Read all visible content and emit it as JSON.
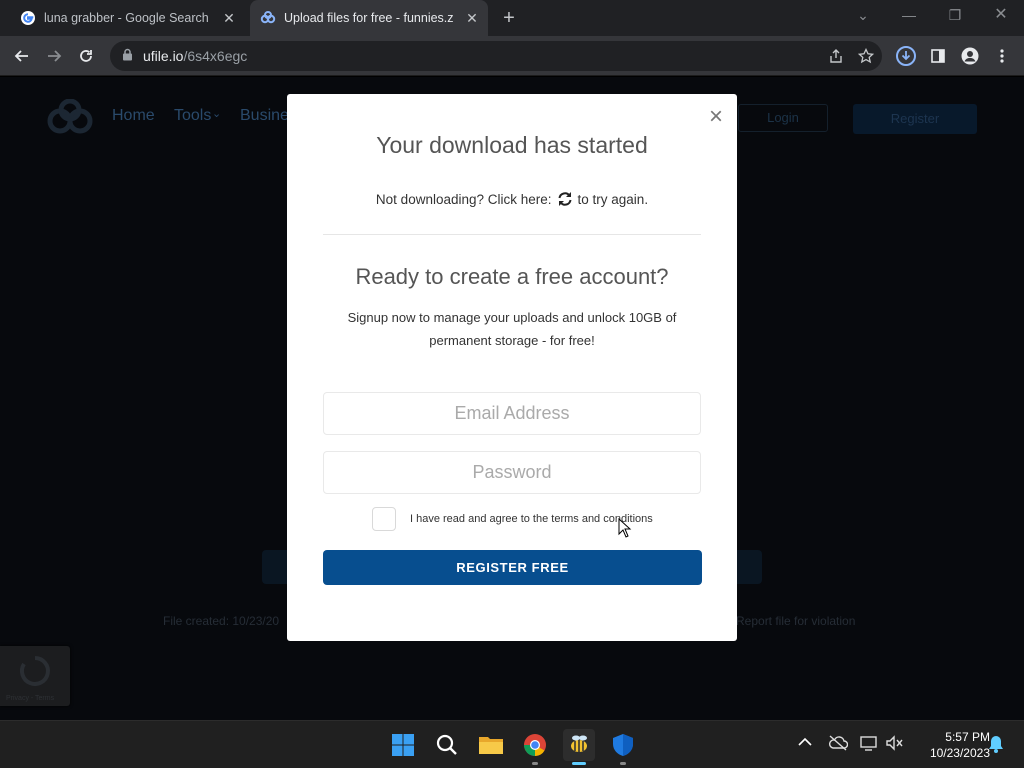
{
  "browser": {
    "tabs": [
      {
        "title": "luna grabber - Google Search",
        "icon": "google-icon",
        "active": false
      },
      {
        "title": "Upload files for free - funnies.zip",
        "icon": "ufile-icon",
        "active": true
      }
    ],
    "url_host": "ufile.io",
    "url_path": "/6s4x6egc"
  },
  "site": {
    "nav": [
      "Home",
      "Tools",
      "Busine"
    ],
    "login_label": "Login",
    "register_label": "Register",
    "file_created": "File created: 10/23/20",
    "report_label": "Report file for violation",
    "recaptcha_text": "Privacy - Terms"
  },
  "modal": {
    "close_symbol": "×",
    "download_title": "Your download has started",
    "not_downloading_prefix": "Not downloading? Click here:",
    "not_downloading_suffix": "to try again.",
    "account_title": "Ready to create a free account?",
    "account_desc": "Signup now to manage your uploads and unlock 10GB of permanent storage - for free!",
    "email_placeholder": "Email Address",
    "password_placeholder": "Password",
    "terms_label": "I have read and agree to the terms and conditions",
    "submit_label": "REGISTER FREE",
    "accent_color": "#074e8f"
  },
  "taskbar": {
    "time": "5:57 PM",
    "date": "10/23/2023"
  }
}
